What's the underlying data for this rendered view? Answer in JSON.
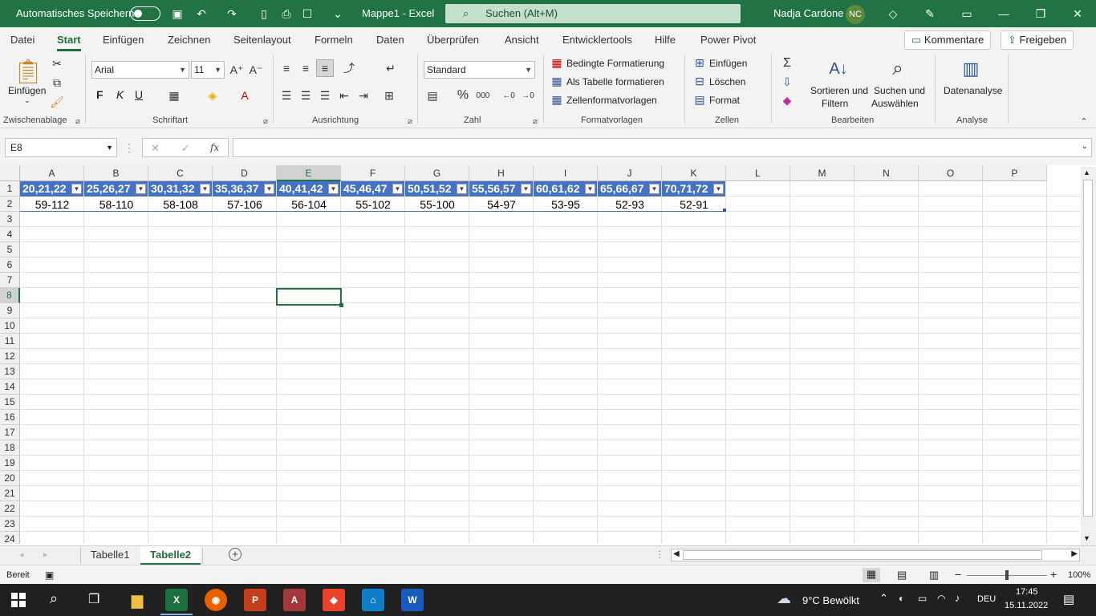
{
  "titlebar": {
    "autosave_label": "Automatisches Speichern",
    "doc_title": "Mappe1  -  Excel",
    "search_placeholder": "Suchen (Alt+M)",
    "user_name": "Nadja Cardone",
    "user_initials": "NC"
  },
  "ribbon_tabs": [
    "Datei",
    "Start",
    "Einfügen",
    "Zeichnen",
    "Seitenlayout",
    "Formeln",
    "Daten",
    "Überprüfen",
    "Ansicht",
    "Entwicklertools",
    "Hilfe",
    "Power Pivot"
  ],
  "active_ribbon_tab": "Start",
  "ribbon_actions": {
    "comments": "Kommentare",
    "share": "Freigeben"
  },
  "ribbon": {
    "clipboard": {
      "paste": "Einfügen",
      "group": "Zwischenablage"
    },
    "font": {
      "name": "Arial",
      "size": "11",
      "bold": "F",
      "italic": "K",
      "underline": "U",
      "group": "Schriftart"
    },
    "alignment": {
      "group": "Ausrichtung"
    },
    "number": {
      "format": "Standard",
      "group": "Zahl"
    },
    "styles": {
      "conditional": "Bedingte Formatierung",
      "as_table": "Als Tabelle formatieren",
      "cell_styles": "Zellenformatvorlagen",
      "group": "Formatvorlagen"
    },
    "cells": {
      "insert": "Einfügen",
      "delete": "Löschen",
      "format": "Format",
      "group": "Zellen"
    },
    "editing": {
      "sort_1": "Sortieren und",
      "sort_2": "Filtern",
      "find_1": "Suchen und",
      "find_2": "Auswählen",
      "group": "Bearbeiten"
    },
    "analysis": {
      "data_analysis": "Datenanalyse",
      "group": "Analyse"
    }
  },
  "formula_bar": {
    "name_box": "E8",
    "fx": "fx",
    "content": ""
  },
  "grid": {
    "columns": [
      "A",
      "B",
      "C",
      "D",
      "E",
      "F",
      "G",
      "H",
      "I",
      "J",
      "K",
      "L",
      "M",
      "N",
      "O",
      "P"
    ],
    "rows": [
      "1",
      "2",
      "3",
      "4",
      "5",
      "6",
      "7",
      "8",
      "9",
      "10",
      "11",
      "12",
      "13",
      "14",
      "15",
      "16",
      "17",
      "18",
      "19",
      "20",
      "21",
      "22",
      "23",
      "24"
    ],
    "selected_cell": "E8",
    "table_header": [
      "20,21,22",
      "25,26,27",
      "30,31,32",
      "35,36,37",
      "40,41,42",
      "45,46,47",
      "50,51,52",
      "55,56,57",
      "60,61,62",
      "65,66,67",
      "70,71,72"
    ],
    "table_row": [
      "59-112",
      "58-110",
      "58-108",
      "57-106",
      "56-104",
      "55-102",
      "55-100",
      "54-97",
      "53-95",
      "52-93",
      "52-91"
    ]
  },
  "sheets": {
    "tabs": [
      "Tabelle1",
      "Tabelle2"
    ],
    "active": "Tabelle2"
  },
  "status": {
    "ready": "Bereit",
    "zoom": "100%"
  },
  "taskbar": {
    "weather": "9°C  Bewölkt",
    "lang": "DEU",
    "time": "17:45",
    "date": "15.11.2022"
  },
  "colors": {
    "excel_green": "#217346",
    "table_blue": "#4472c4"
  }
}
